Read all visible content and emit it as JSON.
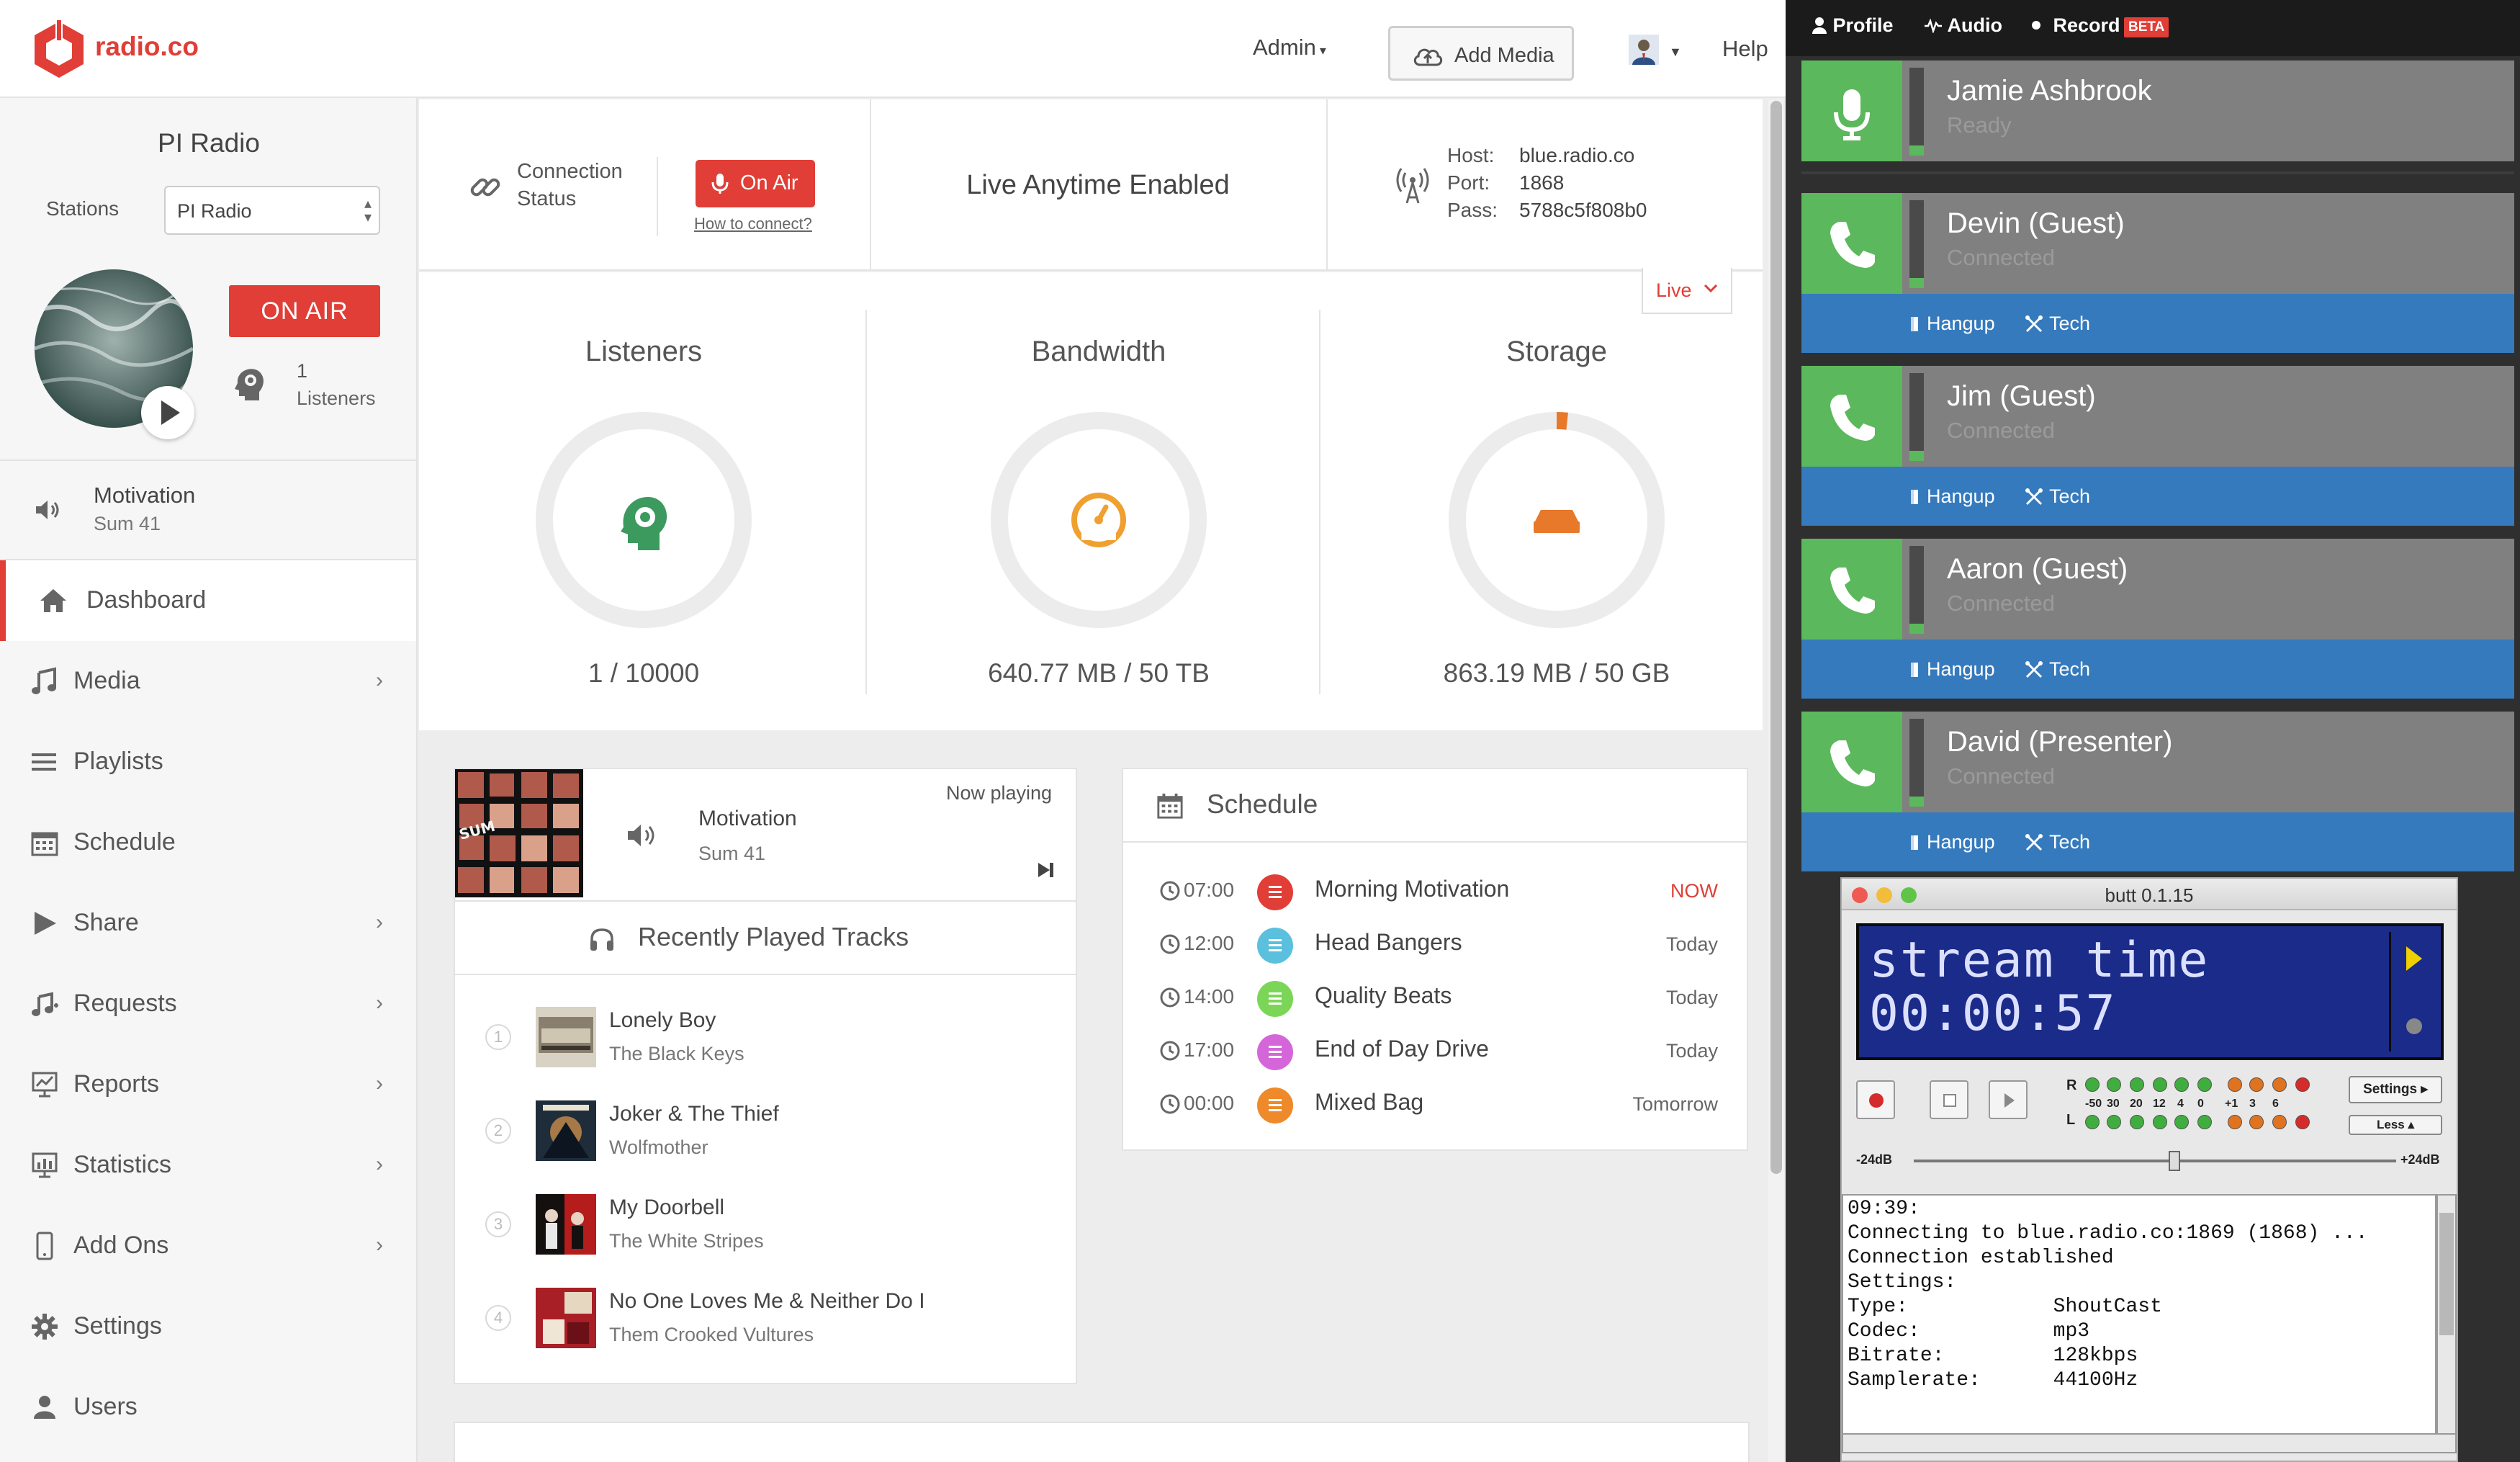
{
  "brand": {
    "name": "radio.co",
    "color": "#e03e36"
  },
  "topbar": {
    "admin": "Admin",
    "add_media": "Add Media",
    "help": "Help"
  },
  "sidebar": {
    "station_name": "PI Radio",
    "stations_label": "Stations",
    "station_select": "PI Radio",
    "on_air": "ON AIR",
    "listeners_count": "1",
    "listeners_label": "Listeners",
    "now_playing": {
      "title": "Motivation",
      "artist": "Sum 41"
    },
    "nav": [
      {
        "label": "Dashboard",
        "icon": "home-icon",
        "active": true
      },
      {
        "label": "Media",
        "icon": "music-note-icon",
        "chevron": true
      },
      {
        "label": "Playlists",
        "icon": "list-icon"
      },
      {
        "label": "Schedule",
        "icon": "calendar-icon"
      },
      {
        "label": "Share",
        "icon": "play-icon",
        "chevron": true
      },
      {
        "label": "Requests",
        "icon": "music-request-icon",
        "chevron": true
      },
      {
        "label": "Reports",
        "icon": "report-icon",
        "chevron": true
      },
      {
        "label": "Statistics",
        "icon": "statistics-icon",
        "chevron": true
      },
      {
        "label": "Add Ons",
        "icon": "mobile-icon",
        "chevron": true
      },
      {
        "label": "Settings",
        "icon": "gear-icon"
      },
      {
        "label": "Users",
        "icon": "user-icon"
      }
    ]
  },
  "status": {
    "connection_line1": "Connection",
    "connection_line2": "Status",
    "on_air_button": "On Air",
    "how_to": "How to connect?",
    "live_anytime": "Live Anytime Enabled",
    "host_label": "Host:",
    "host": "blue.radio.co",
    "port_label": "Port:",
    "port": "1868",
    "pass_label": "Pass:",
    "pass": "5788c5f808b0",
    "live_dropdown": "Live"
  },
  "stats": {
    "listeners": {
      "title": "Listeners",
      "value": "1 / 10000",
      "fraction": 0.0001
    },
    "bandwidth": {
      "title": "Bandwidth",
      "value": "640.77 MB / 50 TB",
      "fraction": 0.0
    },
    "storage": {
      "title": "Storage",
      "value": "863.19 MB / 50 GB",
      "fraction": 0.017
    }
  },
  "now_playing_card": {
    "label": "Now playing",
    "title": "Motivation",
    "artist": "Sum 41",
    "recent_header": "Recently Played Tracks",
    "tracks": [
      {
        "num": "1",
        "title": "Lonely Boy",
        "artist": "The Black Keys"
      },
      {
        "num": "2",
        "title": "Joker & The Thief",
        "artist": "Wolfmother"
      },
      {
        "num": "3",
        "title": "My Doorbell",
        "artist": "The White Stripes"
      },
      {
        "num": "4",
        "title": "No One Loves Me & Neither Do I",
        "artist": "Them Crooked Vultures"
      }
    ]
  },
  "schedule": {
    "title": "Schedule",
    "items": [
      {
        "time": "07:00",
        "name": "Morning Motivation",
        "when": "NOW",
        "color": "#e03e36"
      },
      {
        "time": "12:00",
        "name": "Head Bangers",
        "when": "Today",
        "color": "#5bc0de"
      },
      {
        "time": "14:00",
        "name": "Quality Beats",
        "when": "Today",
        "color": "#7bd657"
      },
      {
        "time": "17:00",
        "name": "End of Day Drive",
        "when": "Today",
        "color": "#d566d9"
      },
      {
        "time": "00:00",
        "name": "Mixed Bag",
        "when": "Tomorrow",
        "color": "#ee8a2a"
      }
    ]
  },
  "studio": {
    "nav": {
      "profile": "Profile",
      "audio": "Audio",
      "record": "Record",
      "beta": "BETA"
    },
    "callers": [
      {
        "name": "Jamie Ashbrook",
        "status": "Ready",
        "icon": "microphone-icon"
      },
      {
        "name": "Devin (Guest)",
        "status": "Connected",
        "icon": "phone-icon"
      },
      {
        "name": "Jim (Guest)",
        "status": "Connected",
        "icon": "phone-icon"
      },
      {
        "name": "Aaron (Guest)",
        "status": "Connected",
        "icon": "phone-icon"
      },
      {
        "name": "David (Presenter)",
        "status": "Connected",
        "icon": "phone-icon"
      }
    ],
    "hangup": "Hangup",
    "tech": "Tech"
  },
  "butt": {
    "title": "butt 0.1.15",
    "lcd_line1": "stream time",
    "lcd_line2": "00:00:57",
    "vu_r": "R",
    "vu_l": "L",
    "vu_scale": [
      "-50",
      "30",
      "20",
      "12",
      "4",
      "0",
      "+1",
      "3",
      "6"
    ],
    "settings": "Settings",
    "less": "Less",
    "gain_min": "-24dB",
    "gain_max": "+24dB",
    "log": "09:39:\nConnecting to blue.radio.co:1869 (1868) ...\nConnection established\nSettings:\nType:            ShoutCast\nCodec:           mp3\nBitrate:         128kbps\nSamplerate:      44100Hz"
  }
}
